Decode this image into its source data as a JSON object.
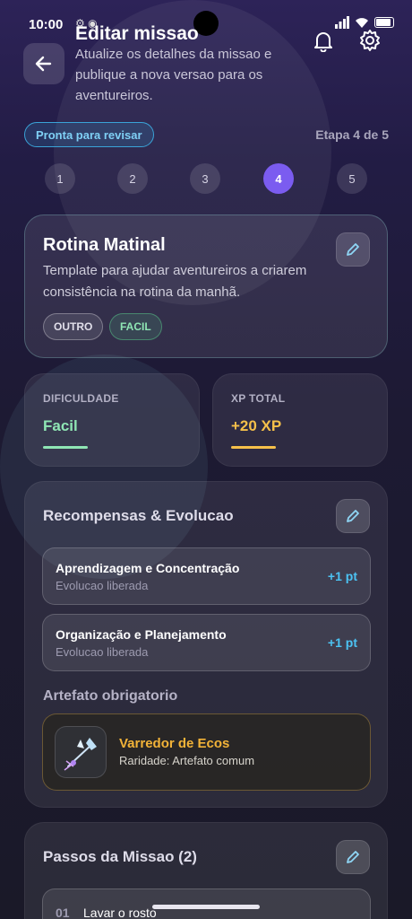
{
  "status_bar": {
    "time": "10:00",
    "icons": "⚙ ◉"
  },
  "header": {
    "title": "Editar missao",
    "subtitle": "Atualize os detalhes da missao e publique a nova versao para os aventureiros."
  },
  "progress": {
    "badge": "Pronta para revisar",
    "step_label": "Etapa 4 de 5",
    "steps": [
      "1",
      "2",
      "3",
      "4",
      "5"
    ],
    "current_step": 4
  },
  "summary": {
    "title": "Rotina Matinal",
    "description": "Template para ajudar aventureiros a criarem consistência na rotina da manhã.",
    "tags": [
      "OUTRO",
      "FACIL"
    ]
  },
  "stats": {
    "difficulty_label": "DIFICULDADE",
    "difficulty_value": "Facil",
    "xp_label": "XP TOTAL",
    "xp_value": "+20 XP"
  },
  "rewards": {
    "title": "Recompensas & Evolucao",
    "items": [
      {
        "name": "Aprendizagem e Concentração",
        "status": "Evolucao liberada",
        "points": "+1 pt"
      },
      {
        "name": "Organização e Planejamento",
        "status": "Evolucao liberada",
        "points": "+1 pt"
      }
    ],
    "artifact_title": "Artefato obrigatorio",
    "artifact": {
      "name": "Varredor de Ecos",
      "rarity": "Raridade: Artefato comum"
    }
  },
  "mission_steps": {
    "title": "Passos da Missao (2)",
    "items": [
      {
        "number": "01",
        "text": "Lavar o rosto"
      }
    ]
  },
  "colors": {
    "accent": "#7b5cf0",
    "easy_green": "#8fe6b4",
    "xp_gold": "#f5c04a",
    "points_blue": "#4cc3f3",
    "artifact_gold": "#f2b338"
  }
}
